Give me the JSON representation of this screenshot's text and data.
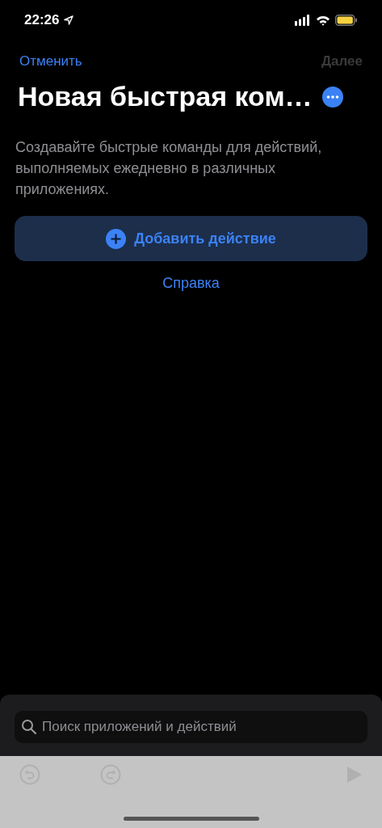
{
  "status_bar": {
    "time": "22:26"
  },
  "nav": {
    "cancel": "Отменить",
    "next": {
      "label": "Далее",
      "disabled": true
    }
  },
  "title": "Новая быстрая ком…",
  "description": "Создавайте быстрые команды для действий, выполняемых ежедневно в различных приложениях.",
  "add_action": "Добавить действие",
  "help": "Справка",
  "search": {
    "placeholder": "Поиск приложений и действий"
  }
}
